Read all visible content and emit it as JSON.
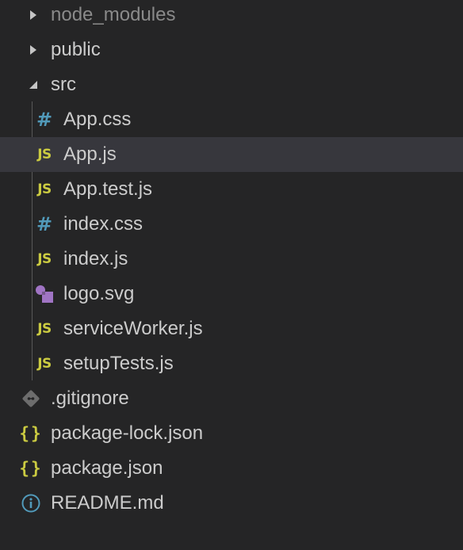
{
  "explorer": {
    "items": [
      {
        "label": "node_modules",
        "kind": "folder",
        "state": "collapsed",
        "icon": "chevron-right-icon",
        "level": 0
      },
      {
        "label": "public",
        "kind": "folder",
        "state": "collapsed",
        "icon": "chevron-right-icon",
        "level": 0
      },
      {
        "label": "src",
        "kind": "folder",
        "state": "expanded",
        "icon": "chevron-down-icon",
        "level": 0
      },
      {
        "label": "App.css",
        "kind": "file",
        "icon": "css-file-icon",
        "glyph": "#",
        "level": 1
      },
      {
        "label": "App.js",
        "kind": "file",
        "icon": "js-file-icon",
        "glyph": "JS",
        "level": 1,
        "selected": true
      },
      {
        "label": "App.test.js",
        "kind": "file",
        "icon": "js-file-icon",
        "glyph": "JS",
        "level": 1
      },
      {
        "label": "index.css",
        "kind": "file",
        "icon": "css-file-icon",
        "glyph": "#",
        "level": 1
      },
      {
        "label": "index.js",
        "kind": "file",
        "icon": "js-file-icon",
        "glyph": "JS",
        "level": 1
      },
      {
        "label": "logo.svg",
        "kind": "file",
        "icon": "svg-file-icon",
        "level": 1
      },
      {
        "label": "serviceWorker.js",
        "kind": "file",
        "icon": "js-file-icon",
        "glyph": "JS",
        "level": 1
      },
      {
        "label": "setupTests.js",
        "kind": "file",
        "icon": "js-file-icon",
        "glyph": "JS",
        "level": 1
      },
      {
        "label": ".gitignore",
        "kind": "file",
        "icon": "git-file-icon",
        "level": 0
      },
      {
        "label": "package-lock.json",
        "kind": "file",
        "icon": "json-file-icon",
        "glyph": "{ }",
        "level": 0
      },
      {
        "label": "package.json",
        "kind": "file",
        "icon": "json-file-icon",
        "glyph": "{ }",
        "level": 0
      },
      {
        "label": "README.md",
        "kind": "file",
        "icon": "info-icon",
        "level": 0
      }
    ]
  },
  "colors": {
    "background": "#252526",
    "selected_row": "#37373d",
    "text": "#cccccc",
    "dim_text": "#8a8a8a",
    "js_yellow": "#cbcb41",
    "css_blue": "#519aba",
    "svg_purple": "#a074c4",
    "git_gray": "#6d6d6d",
    "info_blue": "#519aba"
  }
}
